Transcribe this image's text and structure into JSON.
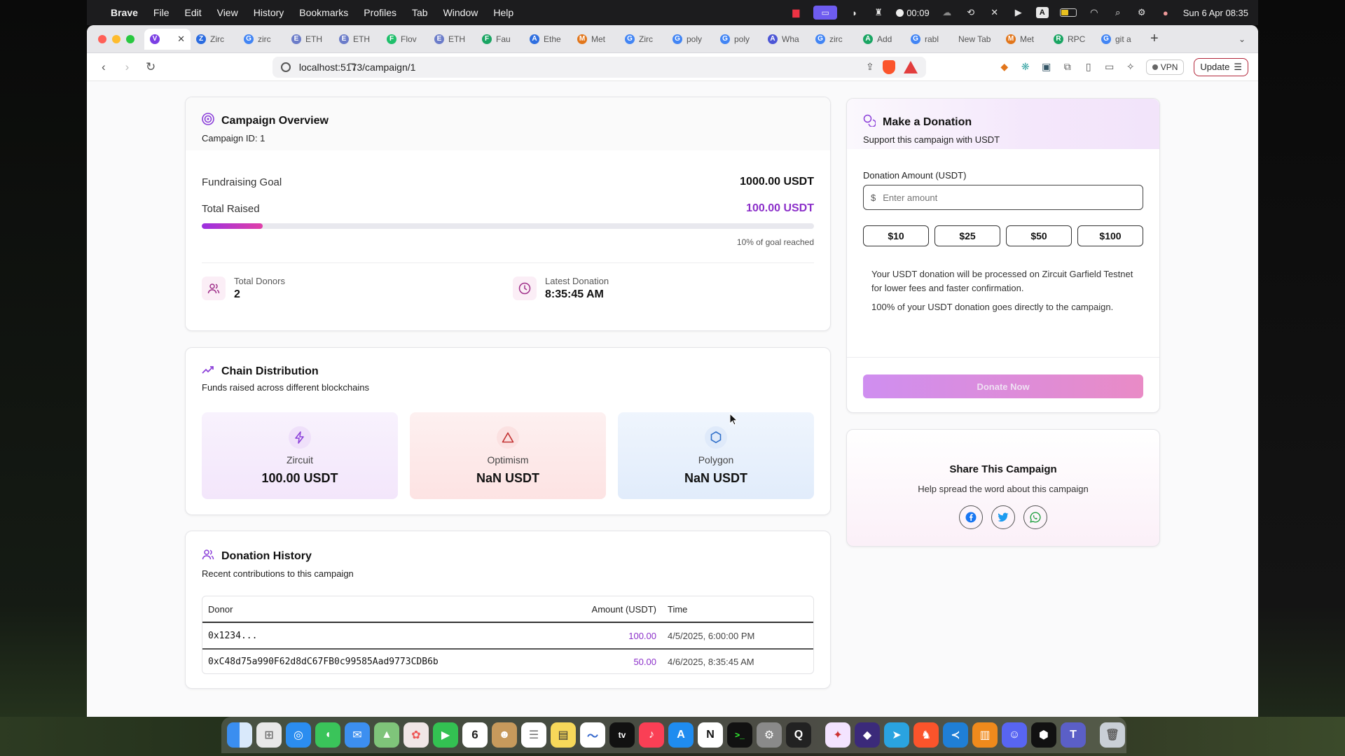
{
  "menubar": {
    "app": "Brave",
    "items": [
      "File",
      "Edit",
      "View",
      "History",
      "Bookmarks",
      "Profiles",
      "Tab",
      "Window",
      "Help"
    ],
    "timer": "00:09",
    "input_indicator": "A",
    "datetime": "Sun 6 Apr  08:35"
  },
  "browser": {
    "tabs": [
      {
        "label": "",
        "fav": "V",
        "color": "#7b3fe4",
        "active": true
      },
      {
        "label": "Zirc",
        "fav": "Z",
        "color": "#2a6be0"
      },
      {
        "label": "zirc",
        "fav": "G",
        "color": "#4285f4"
      },
      {
        "label": "ETH",
        "fav": "E",
        "color": "#6b7cc9"
      },
      {
        "label": "ETH",
        "fav": "E",
        "color": "#6b7cc9"
      },
      {
        "label": "Flov",
        "fav": "F",
        "color": "#1fbf6b"
      },
      {
        "label": "ETH",
        "fav": "E",
        "color": "#6b7cc9"
      },
      {
        "label": "Fau",
        "fav": "F",
        "color": "#1aa563"
      },
      {
        "label": "Ethe",
        "fav": "A",
        "color": "#2f6fe0"
      },
      {
        "label": "Met",
        "fav": "M",
        "color": "#e2761b"
      },
      {
        "label": "Zirc",
        "fav": "G",
        "color": "#4285f4"
      },
      {
        "label": "poly",
        "fav": "G",
        "color": "#4285f4"
      },
      {
        "label": "poly",
        "fav": "G",
        "color": "#4285f4"
      },
      {
        "label": "Wha",
        "fav": "A",
        "color": "#4c56d6"
      },
      {
        "label": "zirc",
        "fav": "G",
        "color": "#4285f4"
      },
      {
        "label": "Add",
        "fav": "A",
        "color": "#1aa563"
      },
      {
        "label": "rabl",
        "fav": "G",
        "color": "#4285f4"
      },
      {
        "label": "New Tab",
        "fav": "",
        "color": "transparent"
      },
      {
        "label": "Met",
        "fav": "M",
        "color": "#e2761b"
      },
      {
        "label": "RPC",
        "fav": "R",
        "color": "#1aa563"
      },
      {
        "label": "git a",
        "fav": "G",
        "color": "#4285f4"
      }
    ],
    "url": "localhost:5173/campaign/1",
    "vpn_label": "VPN",
    "update_label": "Update"
  },
  "overview": {
    "title": "Campaign Overview",
    "campaign_id": "Campaign ID: 1",
    "goal_label": "Fundraising Goal",
    "goal_value": "1000.00 USDT",
    "raised_label": "Total Raised",
    "raised_value": "100.00 USDT",
    "progress_fraction": 0.1,
    "progress_note": "10% of goal reached",
    "donors_label": "Total Donors",
    "donors_value": "2",
    "latest_label": "Latest Donation",
    "latest_value": "8:35:45 AM"
  },
  "chains": {
    "title": "Chain Distribution",
    "subtitle": "Funds raised across different blockchains",
    "items": [
      {
        "name": "Zircuit",
        "value": "100.00 USDT",
        "icon": "bolt-icon"
      },
      {
        "name": "Optimism",
        "value": "NaN USDT",
        "icon": "triangle-icon"
      },
      {
        "name": "Polygon",
        "value": "NaN USDT",
        "icon": "hexagon-icon"
      }
    ]
  },
  "history": {
    "title": "Donation History",
    "subtitle": "Recent contributions to this campaign",
    "columns": [
      "Donor",
      "Amount (USDT)",
      "Time"
    ],
    "rows": [
      {
        "donor": "0x1234...",
        "amount": "100.00",
        "time": "4/5/2025, 6:00:00 PM"
      },
      {
        "donor": "0xC48d75a990F62d8dC67FB0c99585Aad9773CDB6b",
        "amount": "50.00",
        "time": "4/6/2025, 8:35:45 AM"
      }
    ]
  },
  "donation": {
    "title": "Make a Donation",
    "subtitle": "Support this campaign with USDT",
    "amount_label": "Donation Amount (USDT)",
    "currency_symbol": "$",
    "placeholder": "Enter amount",
    "presets": [
      "$10",
      "$25",
      "$50",
      "$100"
    ],
    "note1": "Your USDT donation will be processed on Zircuit Garfield Testnet for lower fees and faster confirmation.",
    "note2": "100% of your USDT donation goes directly to the campaign.",
    "button": "Donate Now"
  },
  "share": {
    "title": "Share This Campaign",
    "subtitle": "Help spread the word about this campaign"
  },
  "dock": {
    "calendar_day": "6"
  }
}
